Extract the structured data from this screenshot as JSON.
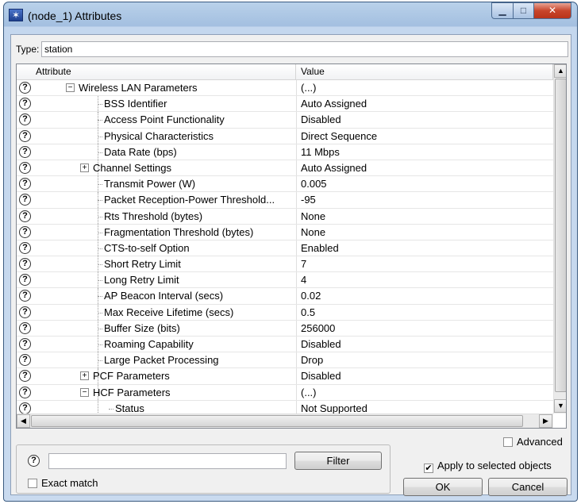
{
  "window": {
    "title": "(node_1) Attributes",
    "min_glyph": "▁",
    "max_glyph": "□",
    "close_glyph": "✕"
  },
  "type_row": {
    "label": "Type:",
    "value": "station"
  },
  "grid": {
    "header_attr": "Attribute",
    "header_value": "Value",
    "rows": [
      {
        "attr": "Wireless LAN Parameters",
        "value": "(...)"
      },
      {
        "attr": "BSS Identifier",
        "value": "Auto Assigned"
      },
      {
        "attr": "Access Point Functionality",
        "value": "Disabled"
      },
      {
        "attr": "Physical Characteristics",
        "value": "Direct Sequence"
      },
      {
        "attr": "Data Rate (bps)",
        "value": "11 Mbps"
      },
      {
        "attr": "Channel Settings",
        "value": "Auto Assigned"
      },
      {
        "attr": "Transmit Power (W)",
        "value": "0.005"
      },
      {
        "attr": "Packet Reception-Power Threshold...",
        "value": "-95"
      },
      {
        "attr": "Rts Threshold (bytes)",
        "value": "None"
      },
      {
        "attr": "Fragmentation Threshold (bytes)",
        "value": "None"
      },
      {
        "attr": "CTS-to-self Option",
        "value": "Enabled"
      },
      {
        "attr": "Short Retry Limit",
        "value": "7"
      },
      {
        "attr": "Long Retry Limit",
        "value": "4"
      },
      {
        "attr": "AP Beacon Interval (secs)",
        "value": "0.02"
      },
      {
        "attr": "Max Receive Lifetime (secs)",
        "value": "0.5"
      },
      {
        "attr": "Buffer Size (bits)",
        "value": "256000"
      },
      {
        "attr": "Roaming Capability",
        "value": "Disabled"
      },
      {
        "attr": "Large Packet Processing",
        "value": "Drop"
      },
      {
        "attr": "PCF Parameters",
        "value": "Disabled"
      },
      {
        "attr": "HCF Parameters",
        "value": "(...)"
      },
      {
        "attr": "Status",
        "value": "Not Supported"
      }
    ],
    "help_glyph": "?",
    "expand_glyph": "+",
    "collapse_glyph": "−",
    "scroll_up": "▲",
    "scroll_down": "▼",
    "scroll_left": "◀",
    "scroll_right": "▶"
  },
  "bottom": {
    "advanced_label": "Advanced",
    "advanced_checked": false,
    "filter_button": "Filter",
    "exact_match_label": "Exact match",
    "exact_match_checked": false,
    "apply_label": "Apply to selected objects",
    "apply_checked": true,
    "ok_label": "OK",
    "cancel_label": "Cancel",
    "check_glyph": "✔"
  }
}
